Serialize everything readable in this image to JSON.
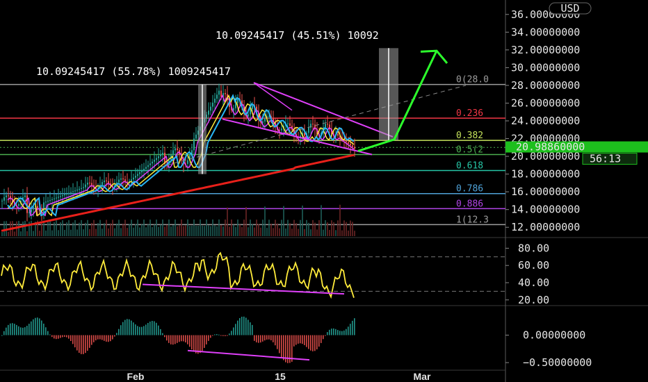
{
  "chart_data": [
    {
      "type": "candlestick",
      "pane": "price",
      "currency_badge": "USD",
      "ylim": [
        11.0,
        37.0
      ],
      "y_ticks": [
        "12.00000000",
        "14.00000000",
        "16.00000000",
        "18.00000000",
        "20.00000000",
        "22.00000000",
        "24.00000000",
        "26.00000000",
        "28.00000000",
        "30.00000000",
        "32.00000000",
        "34.00000000",
        "36.00000000"
      ],
      "y_tick_values": [
        12,
        14,
        16,
        18,
        20,
        22,
        24,
        26,
        28,
        30,
        32,
        34,
        36
      ],
      "x_ticks": [
        "Feb",
        "15",
        "Mar"
      ],
      "last_price": "20.98860000",
      "countdown": "56:13",
      "fib_levels": [
        {
          "label": "0(28.0",
          "value": 28.1,
          "color": "#9e9e9e"
        },
        {
          "label": "0.236",
          "value": 24.3,
          "color": "#f23645"
        },
        {
          "label": "0.382",
          "value": 21.8,
          "color": "#c5e35b"
        },
        {
          "label": "0.5(2",
          "value": 20.2,
          "color": "#4caf50"
        },
        {
          "label": "0.618",
          "value": 18.4,
          "color": "#26c6a6"
        },
        {
          "label": "0.786",
          "value": 15.8,
          "color": "#4fa3d9"
        },
        {
          "label": "0.886",
          "value": 14.1,
          "color": "#b245e8"
        },
        {
          "label": "1(12.3",
          "value": 12.3,
          "color": "#9e9e9e"
        }
      ],
      "measures": [
        {
          "text": "10.09245417 (55.78%) 1009245417"
        },
        {
          "text": "10.09245417 (45.51%) 10092"
        }
      ],
      "colors": {
        "up": "#26a69a",
        "down": "#ef5350",
        "ma_long": "#e8201a",
        "ema_fast": "#e040fb",
        "ema_mid": "#ffeb3b",
        "ema_slow": "#29b6f6",
        "channel": "#e040fb",
        "arrow": "#2cff2c"
      }
    },
    {
      "type": "line",
      "pane": "rsi",
      "ylim": [
        15,
        90
      ],
      "y_ticks": [
        "80.00",
        "60.00",
        "40.00",
        "20.00"
      ],
      "y_tick_values": [
        80,
        60,
        40,
        20
      ],
      "levels": [
        70,
        30
      ],
      "color": "#ffeb3b"
    },
    {
      "type": "histogram",
      "pane": "macd",
      "ylim": [
        -0.6,
        0.5
      ],
      "y_ticks": [
        "0.00000000",
        "−0.50000000"
      ],
      "y_tick_values": [
        0,
        -0.5
      ]
    }
  ]
}
